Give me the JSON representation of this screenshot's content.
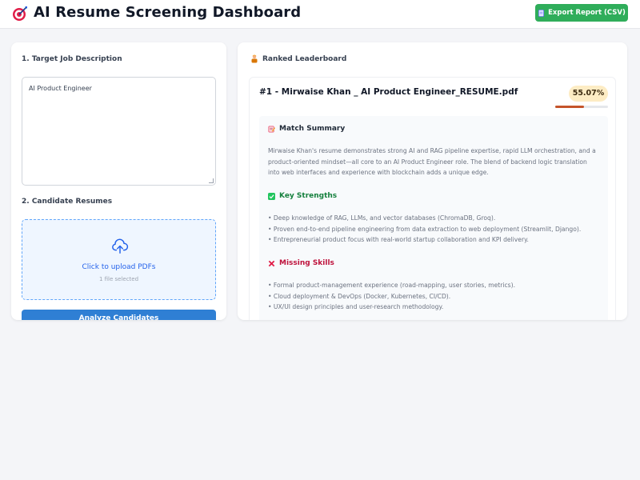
{
  "header": {
    "title": "AI Resume Screening Dashboard",
    "logo_icon": "target-icon",
    "export_label": "Export Report (CSV)",
    "export_icon": "document-icon",
    "export_color": "#2fad5a"
  },
  "left_panel": {
    "job_description_label": "1. Target Job Description",
    "job_description_value": "AI Product Engineer",
    "resumes_label": "2. Candidate Resumes",
    "upload_icon": "cloud-upload-icon",
    "upload_text": "Click to upload PDFs",
    "upload_status": "1 file selected",
    "analyze_label": "Analyze Candidates",
    "analyze_color": "#2f7fd4"
  },
  "leaderboard": {
    "title": "Ranked Leaderboard",
    "icon": "trophy-person-icon",
    "candidates": [
      {
        "title": "#1 - Mirwaise Khan _ AI Product Engineer_RESUME.pdf",
        "score": "55.07%",
        "score_fraction": 0.5507,
        "score_color": "#c5542a",
        "summary_heading": "Match Summary",
        "summary_icon": "memo-icon",
        "summary_text": "Mirwaise Khan's resume demonstrates strong AI and RAG pipeline expertise, rapid LLM orchestration, and a product-oriented mindset—all core to an AI Product Engineer role. The blend of backend logic translation into web interfaces and experience with blockchain adds a unique edge.",
        "strengths_heading": "Key Strengths",
        "strengths_icon": "check-mark-icon",
        "strengths": [
          "• Deep knowledge of RAG, LLMs, and vector databases (ChromaDB, Groq).",
          "• Proven end-to-end pipeline engineering from data extraction to web deployment (Streamlit, Django).",
          "• Entrepreneurial product focus with real-world startup collaboration and KPI delivery."
        ],
        "missing_heading": "Missing Skills",
        "missing_icon": "cross-mark-icon",
        "missing": [
          "• Formal product-management experience (road-mapping, user stories, metrics).",
          "• Cloud deployment & DevOps (Docker, Kubernetes, CI/CD).",
          "• UX/UI design principles and user-research methodology."
        ]
      }
    ]
  }
}
